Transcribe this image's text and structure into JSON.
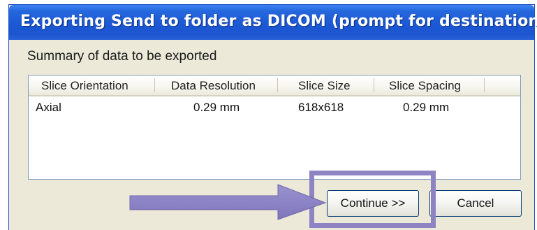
{
  "window": {
    "title": "Exporting Send to folder as DICOM (prompt for destination)"
  },
  "summary": {
    "label": "Summary of data to be exported"
  },
  "table": {
    "columns": [
      "Slice Orientation",
      "Data Resolution",
      "Slice Size",
      "Slice Spacing"
    ],
    "rows": [
      [
        "Axial",
        "0.29 mm",
        "618x618",
        "0.29 mm"
      ]
    ]
  },
  "buttons": {
    "continue_label": "Continue >>",
    "cancel_label": "Cancel"
  },
  "colors": {
    "titlebar": "#1d55cf",
    "dialog_bg": "#ece9d8",
    "annotation": "#8e84c4"
  },
  "icons": {
    "annotation_arrow": "arrow-right-icon"
  }
}
